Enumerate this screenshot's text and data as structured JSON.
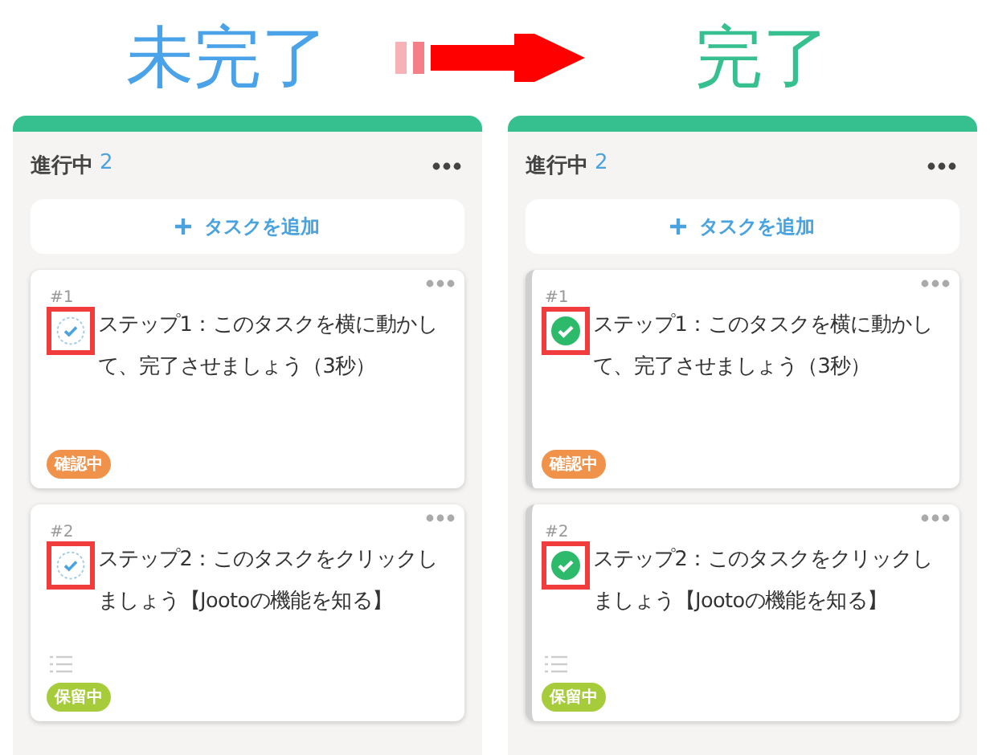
{
  "heading": {
    "before": "未完了",
    "after": "完了"
  },
  "columns": [
    {
      "title": "進行中",
      "count": "2",
      "add_label": "タスクを追加",
      "cards": [
        {
          "number": "#1",
          "title": "ステップ1：このタスクを横に動かして、完了させましょう（3秒）",
          "checked": false,
          "has_list": false,
          "tag": {
            "label": "確認中",
            "color": "#f0924a"
          }
        },
        {
          "number": "#2",
          "title": "ステップ2：このタスクをクリックしましょう【Jootoの機能を知る】",
          "checked": false,
          "has_list": true,
          "tag": {
            "label": "保留中",
            "color": "#a6cc3c"
          }
        }
      ]
    },
    {
      "title": "進行中",
      "count": "2",
      "add_label": "タスクを追加",
      "cards": [
        {
          "number": "#1",
          "title": "ステップ1：このタスクを横に動かして、完了させましょう（3秒）",
          "checked": true,
          "has_list": false,
          "tag": {
            "label": "確認中",
            "color": "#f0924a"
          }
        },
        {
          "number": "#2",
          "title": "ステップ2：このタスクをクリックしましょう【Jootoの機能を知る】",
          "checked": true,
          "has_list": true,
          "tag": {
            "label": "保留中",
            "color": "#a6cc3c"
          }
        }
      ]
    }
  ]
}
